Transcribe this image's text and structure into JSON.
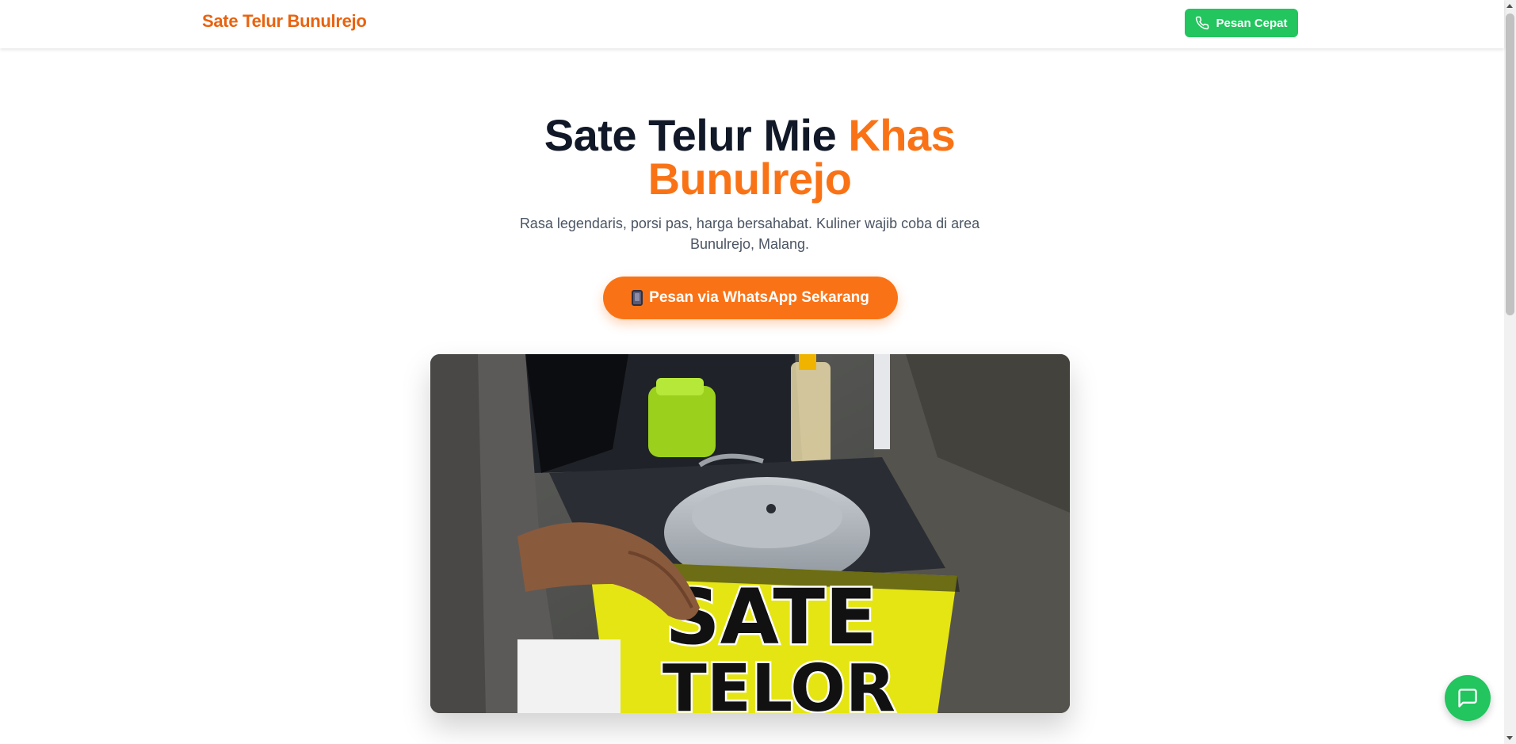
{
  "navbar": {
    "brand": "Sate Telur Bunulrejo",
    "quick_order_label": "Pesan Cepat",
    "quick_order_icon": "phone-icon"
  },
  "hero": {
    "title_main": "Sate Telur Mie ",
    "title_accent": "Khas Bunulrejo",
    "subtitle": "Rasa legendaris, porsi pas, harga bersahabat. Kuliner wajib coba di area Bunulrejo, Malang.",
    "cta_label": "Pesan via WhatsApp Sekarang",
    "cta_icon": "mobile-phone-icon",
    "image": {
      "sign_line_1": "SATE",
      "sign_line_2": "TELOR"
    }
  },
  "chat_fab": {
    "icon": "chat-bubble-icon"
  },
  "colors": {
    "brand_orange": "#f97316",
    "brand_orange_dark": "#e8630f",
    "whatsapp_green": "#22c55e",
    "text_dark": "#111827",
    "text_muted": "#4b5563"
  }
}
